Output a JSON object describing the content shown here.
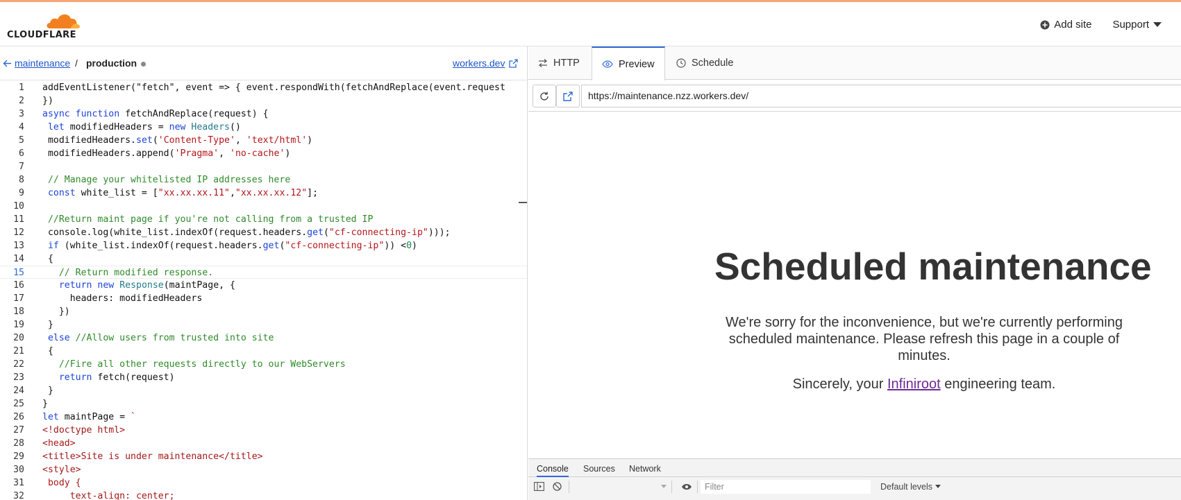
{
  "brand": {
    "name": "CLOUDFLARE",
    "colors": {
      "orange": "#f38020",
      "light_orange": "#faae40"
    }
  },
  "header": {
    "add_site": "Add site",
    "support": "Support"
  },
  "breadcrumb": {
    "parent": "maintenance",
    "separator": "/",
    "current": "production",
    "workers_link": "workers.dev"
  },
  "code_lines": [
    {
      "n": "1"
    },
    {
      "n": "2"
    },
    {
      "n": "3"
    },
    {
      "n": "4"
    },
    {
      "n": "5"
    },
    {
      "n": "6"
    },
    {
      "n": "7"
    },
    {
      "n": "8"
    },
    {
      "n": "9"
    },
    {
      "n": "10"
    },
    {
      "n": "11"
    },
    {
      "n": "12"
    },
    {
      "n": "13"
    },
    {
      "n": "14"
    },
    {
      "n": "15"
    },
    {
      "n": "16"
    },
    {
      "n": "17"
    },
    {
      "n": "18"
    },
    {
      "n": "19"
    },
    {
      "n": "20"
    },
    {
      "n": "21"
    },
    {
      "n": "22"
    },
    {
      "n": "23"
    },
    {
      "n": "24"
    },
    {
      "n": "25"
    },
    {
      "n": "26"
    },
    {
      "n": "27"
    },
    {
      "n": "28"
    },
    {
      "n": "29"
    },
    {
      "n": "30"
    },
    {
      "n": "31"
    },
    {
      "n": "32"
    }
  ],
  "code": {
    "l1": "addEventListener(\"fetch\", event => { event.respondWith(fetchAndReplace(event.request",
    "l2": "})",
    "l3a": "async function",
    "l3b": " fetchAndReplace(request) {",
    "l4a": "let",
    "l4b": " modifiedHeaders = ",
    "l4c": "new",
    "l4d": "Headers",
    "l4e": "()",
    "l5a": "modifiedHeaders.",
    "l5b": "set",
    "l5c": "(",
    "l5d": "'Content-Type'",
    "l5e": ", ",
    "l5f": "'text/html'",
    "l5g": ")",
    "l6a": "modifiedHeaders.append(",
    "l6b": "'Pragma'",
    "l6c": ", ",
    "l6d": "'no-cache'",
    "l6e": ")",
    "l8": "// Manage your whitelisted IP addresses here",
    "l9a": "const",
    "l9b": " white_list = [",
    "l9c": "\"xx.xx.xx.11\"",
    "l9d": ",",
    "l9e": "\"xx.xx.xx.12\"",
    "l9f": "];",
    "l11": "//Return maint page if you're not calling from a trusted IP",
    "l12a": "console.log(white_list.indexOf(request.headers.",
    "l12b": "get",
    "l12c": "(",
    "l12d": "\"cf-connecting-ip\"",
    "l12e": ")));",
    "l13a": "if",
    "l13b": " (white_list.indexOf(request.headers.",
    "l13c": "get",
    "l13d": "(",
    "l13e": "\"cf-connecting-ip\"",
    "l13f": ")) <",
    "l13g": "0",
    "l13h": ")",
    "l14": "{",
    "l15": "// Return modified response.",
    "l16a": "return",
    "l16b": "new",
    "l16c": "Response",
    "l16d": "(maintPage, {",
    "l17": "headers: modifiedHeaders",
    "l18": "})",
    "l19": "}",
    "l20a": "else",
    "l20b": " //Allow users from trusted into site",
    "l21": "{",
    "l22": "//Fire all other requests directly to our WebServers",
    "l23a": "return",
    "l23b": " fetch(request)",
    "l24": "}",
    "l25": "}",
    "l26a": "let",
    "l26b": " maintPage = ",
    "l26c": "`",
    "l27": "<!doctype html>",
    "l28": "<head>",
    "l29": "<title>Site is under maintenance</title>",
    "l30": "<style>",
    "l31": "body {",
    "l32": "text-align: center;"
  },
  "tabs": [
    {
      "label": "HTTP"
    },
    {
      "label": "Preview"
    },
    {
      "label": "Schedule"
    }
  ],
  "url": "https://maintenance.nzz.workers.dev/",
  "preview": {
    "title": "Scheduled maintenance",
    "body": "We're sorry for the inconvenience, but we're currently performing scheduled maintenance. Please refresh this page in a couple of minutes.",
    "sign_pre": "Sincerely, your ",
    "sign_link": "Infiniroot",
    "sign_post": " engineering team."
  },
  "devtools": {
    "tabs": [
      "Console",
      "Sources",
      "Network"
    ],
    "filter_placeholder": "Filter",
    "levels": "Default levels"
  }
}
